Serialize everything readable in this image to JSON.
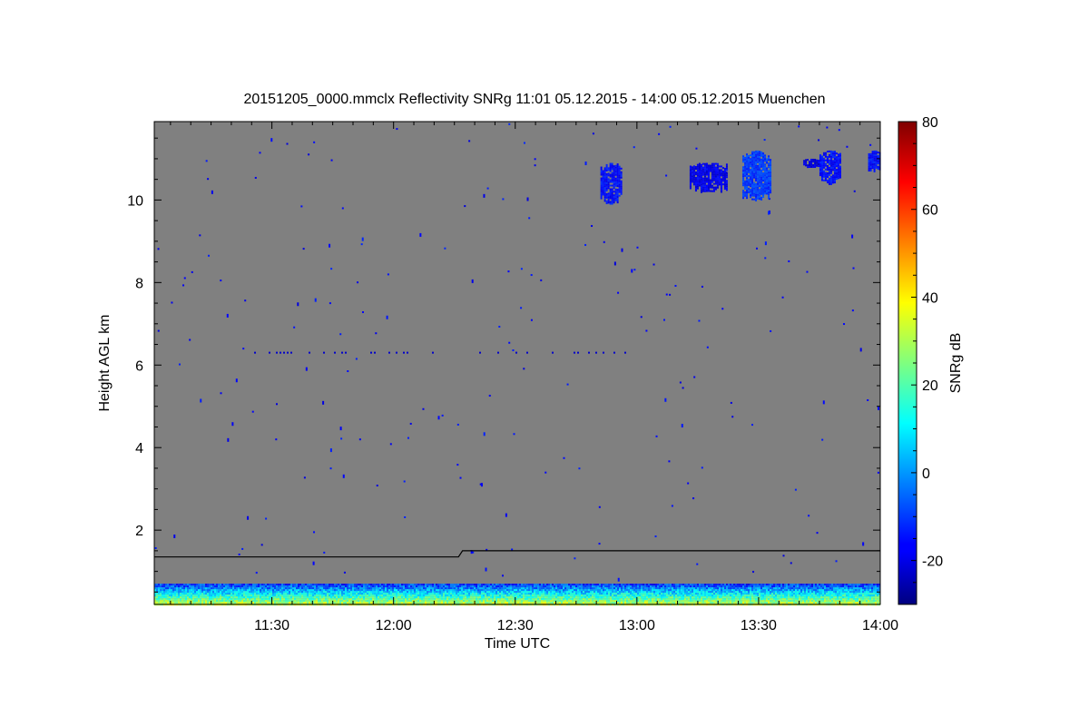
{
  "chart_data": {
    "type": "heatmap",
    "title": "20151205_0000.mmclx Reflectivity SNRg   11:01 05.12.2015 - 14:00 05.12.2015 Muenchen",
    "xlabel": "Time UTC",
    "ylabel": "Height AGL km",
    "colorbar_label": "SNRg dB",
    "x_start": "11:01",
    "x_end": "14:00",
    "x_ticks": [
      "11:30",
      "12:00",
      "12:30",
      "13:00",
      "13:30",
      "14:00"
    ],
    "ylim": [
      0.2,
      11.9
    ],
    "y_ticks": [
      2,
      4,
      6,
      8,
      10
    ],
    "colorbar_range": [
      -30,
      80
    ],
    "colorbar_ticks": [
      -20,
      0,
      20,
      40,
      60,
      80
    ],
    "colormap": "jet",
    "background_color": "#808080",
    "boundary_layer_line": [
      {
        "time": "11:01",
        "height_km": 1.35
      },
      {
        "time": "12:16",
        "height_km": 1.35
      },
      {
        "time": "12:17",
        "height_km": 1.5
      },
      {
        "time": "14:00",
        "height_km": 1.5
      }
    ],
    "cloud_patches": [
      {
        "time_start": "12:51",
        "time_end": "12:56",
        "height_min_km": 9.9,
        "height_max_km": 10.9,
        "snr_db": -15
      },
      {
        "time_start": "13:13",
        "time_end": "13:22",
        "height_min_km": 10.2,
        "height_max_km": 10.9,
        "snr_db": -18
      },
      {
        "time_start": "13:26",
        "time_end": "13:33",
        "height_min_km": 10.0,
        "height_max_km": 11.2,
        "snr_db": -10
      },
      {
        "time_start": "13:41",
        "time_end": "13:45",
        "height_min_km": 10.8,
        "height_max_km": 11.0,
        "snr_db": -20
      },
      {
        "time_start": "13:45",
        "time_end": "13:50",
        "height_min_km": 10.4,
        "height_max_km": 11.2,
        "snr_db": -15
      },
      {
        "time_start": "13:57",
        "time_end": "14:00",
        "height_min_km": 10.7,
        "height_max_km": 11.2,
        "snr_db": -15
      }
    ],
    "noise_line_height_km": 6.3,
    "near_surface_layer": {
      "height_min_km": 0.2,
      "height_max_km": 0.7,
      "snr_db_range": [
        -25,
        35
      ]
    }
  }
}
